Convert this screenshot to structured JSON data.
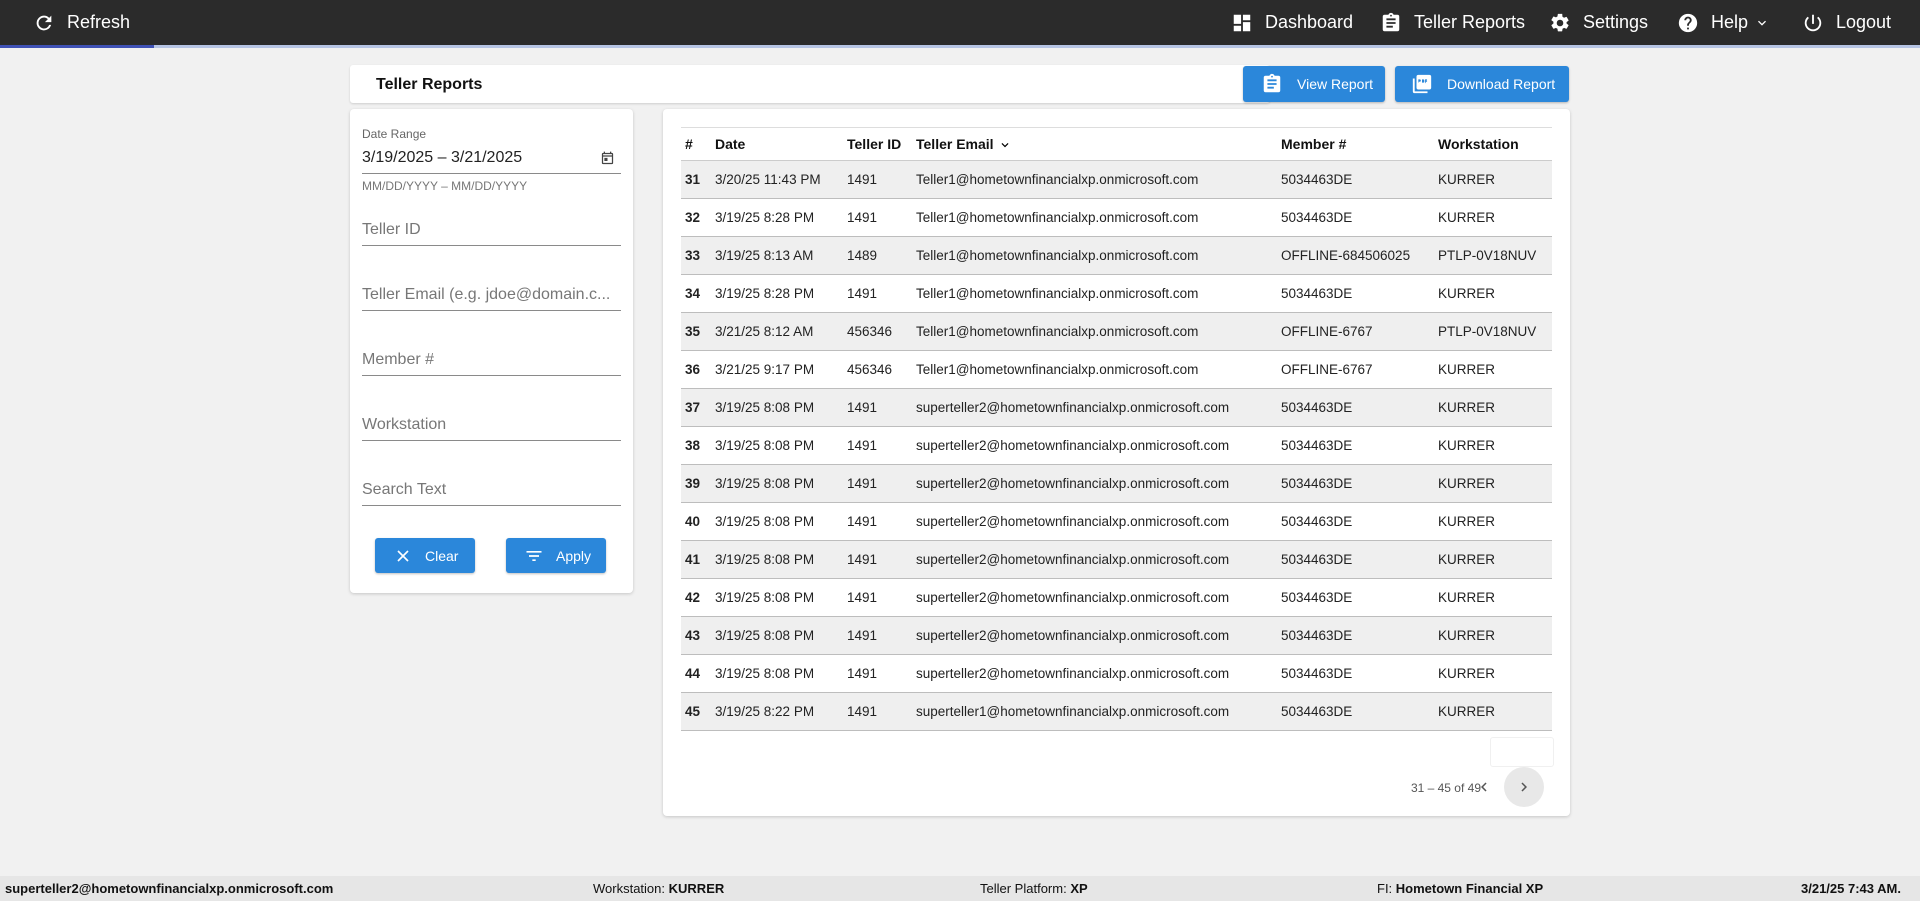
{
  "topbar": {
    "refresh_label": "Refresh",
    "nav": [
      {
        "label": "Dashboard",
        "icon": "dashboard-icon"
      },
      {
        "label": "Teller Reports",
        "icon": "clipboard-icon"
      },
      {
        "label": "Settings",
        "icon": "gear-icon"
      },
      {
        "label": "Help",
        "icon": "help-icon"
      },
      {
        "label": "Logout",
        "icon": "power-icon"
      }
    ],
    "progress_fraction": 0.08
  },
  "header": {
    "title": "Teller Reports",
    "view_report_label": "View Report",
    "download_report_label": "Download Report"
  },
  "filters": {
    "date_range_label": "Date Range",
    "date_range_value": "3/19/2025 – 3/21/2025",
    "date_range_hint": "MM/DD/YYYY – MM/DD/YYYY",
    "teller_id_placeholder": "Teller ID",
    "teller_email_placeholder": "Teller Email (e.g. jdoe@domain.c...",
    "member_placeholder": "Member #",
    "workstation_placeholder": "Workstation",
    "search_placeholder": "Search Text",
    "clear_label": "Clear",
    "apply_label": "Apply"
  },
  "table": {
    "columns": [
      "#",
      "Date",
      "Teller ID",
      "Teller Email",
      "Member #",
      "Workstation"
    ],
    "rows": [
      [
        "31",
        "3/20/25 11:43 PM",
        "1491",
        "Teller1@hometownfinancialxp.onmicrosoft.com",
        "5034463DE",
        "KURRER"
      ],
      [
        "32",
        "3/19/25 8:28 PM",
        "1491",
        "Teller1@hometownfinancialxp.onmicrosoft.com",
        "5034463DE",
        "KURRER"
      ],
      [
        "33",
        "3/19/25 8:13 AM",
        "1489",
        "Teller1@hometownfinancialxp.onmicrosoft.com",
        "OFFLINE-684506025",
        "PTLP-0V18NUV"
      ],
      [
        "34",
        "3/19/25 8:28 PM",
        "1491",
        "Teller1@hometownfinancialxp.onmicrosoft.com",
        "5034463DE",
        "KURRER"
      ],
      [
        "35",
        "3/21/25 8:12 AM",
        "456346",
        "Teller1@hometownfinancialxp.onmicrosoft.com",
        "OFFLINE-6767",
        "PTLP-0V18NUV"
      ],
      [
        "36",
        "3/21/25 9:17 PM",
        "456346",
        "Teller1@hometownfinancialxp.onmicrosoft.com",
        "OFFLINE-6767",
        "KURRER"
      ],
      [
        "37",
        "3/19/25 8:08 PM",
        "1491",
        "superteller2@hometownfinancialxp.onmicrosoft.com",
        "5034463DE",
        "KURRER"
      ],
      [
        "38",
        "3/19/25 8:08 PM",
        "1491",
        "superteller2@hometownfinancialxp.onmicrosoft.com",
        "5034463DE",
        "KURRER"
      ],
      [
        "39",
        "3/19/25 8:08 PM",
        "1491",
        "superteller2@hometownfinancialxp.onmicrosoft.com",
        "5034463DE",
        "KURRER"
      ],
      [
        "40",
        "3/19/25 8:08 PM",
        "1491",
        "superteller2@hometownfinancialxp.onmicrosoft.com",
        "5034463DE",
        "KURRER"
      ],
      [
        "41",
        "3/19/25 8:08 PM",
        "1491",
        "superteller2@hometownfinancialxp.onmicrosoft.com",
        "5034463DE",
        "KURRER"
      ],
      [
        "42",
        "3/19/25 8:08 PM",
        "1491",
        "superteller2@hometownfinancialxp.onmicrosoft.com",
        "5034463DE",
        "KURRER"
      ],
      [
        "43",
        "3/19/25 8:08 PM",
        "1491",
        "superteller2@hometownfinancialxp.onmicrosoft.com",
        "5034463DE",
        "KURRER"
      ],
      [
        "44",
        "3/19/25 8:08 PM",
        "1491",
        "superteller2@hometownfinancialxp.onmicrosoft.com",
        "5034463DE",
        "KURRER"
      ],
      [
        "45",
        "3/19/25 8:22 PM",
        "1491",
        "superteller1@hometownfinancialxp.onmicrosoft.com",
        "5034463DE",
        "KURRER"
      ]
    ],
    "pagination": "31 – 45 of 49"
  },
  "statusbar": {
    "user": "superteller2@hometownfinancialxp.onmicrosoft.com",
    "workstation_label": "Workstation:",
    "workstation_value": "KURRER",
    "platform_label": "Teller Platform:",
    "platform_value": "XP",
    "fi_label": "FI:",
    "fi_value": "Hometown Financial XP",
    "datetime": "3/21/25 7:43 AM."
  },
  "colors": {
    "topbar_bg": "#2b2b2b",
    "primary_button": "#2b87da",
    "progress_fill": "#3f51b5",
    "page_bg": "#f1f1f1"
  }
}
